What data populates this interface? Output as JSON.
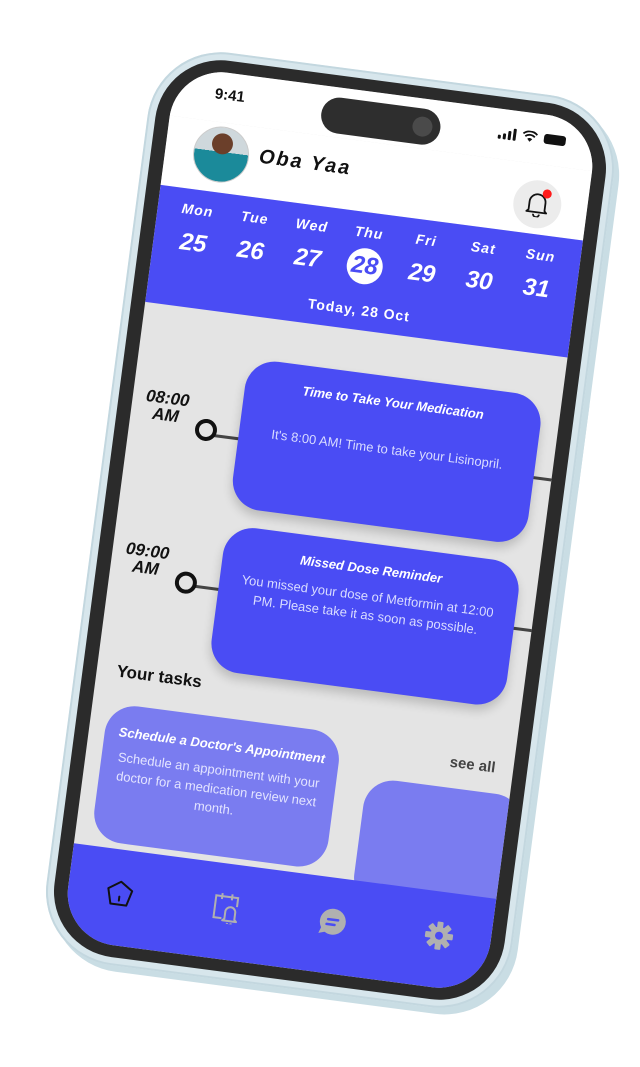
{
  "status_bar": {
    "time": "9:41"
  },
  "header": {
    "user_name": "Oba Yaa",
    "avatar_icon": "user-avatar-photo",
    "notification_icon": "bell-icon",
    "has_unread_notification": true
  },
  "calendar": {
    "days": [
      {
        "name": "Mon",
        "date": "25",
        "active": false
      },
      {
        "name": "Tue",
        "date": "26",
        "active": false
      },
      {
        "name": "Wed",
        "date": "27",
        "active": false
      },
      {
        "name": "Thu",
        "date": "28",
        "active": true
      },
      {
        "name": "Fri",
        "date": "29",
        "active": false
      },
      {
        "name": "Sat",
        "date": "30",
        "active": false
      },
      {
        "name": "Sun",
        "date": "31",
        "active": false
      }
    ],
    "today_label": "Today, 28 Oct"
  },
  "timeline": [
    {
      "time_line1": "08:00",
      "time_line2": "AM",
      "title": "Time to Take Your Medication",
      "body": "It's 8:00 AM! Time to take your Lisinopril."
    },
    {
      "time_line1": "09:00",
      "time_line2": "AM",
      "title": "Missed Dose Reminder",
      "body": "You missed your dose of Metformin at 12:00 PM. Please take it as soon as possible."
    }
  ],
  "tasks": {
    "title": "Your tasks",
    "see_all_label": "see all",
    "items": [
      {
        "title": "Schedule a Doctor's Appointment",
        "body": "Schedule an appointment with your doctor for a medication review next month."
      },
      {
        "title": "",
        "body": ""
      }
    ]
  },
  "bottom_nav": {
    "items": [
      {
        "icon": "home-icon",
        "active": true
      },
      {
        "icon": "calendar-reminder-icon",
        "active": false
      },
      {
        "icon": "chat-icon",
        "active": false
      },
      {
        "icon": "settings-icon",
        "active": false
      }
    ]
  },
  "colors": {
    "primary": "#4a4cf4",
    "task_card": "#7a7cf0",
    "background": "#e4e4e4",
    "notification_dot": "#ff1a1a",
    "inactive_icon": "#b0b0b0"
  }
}
